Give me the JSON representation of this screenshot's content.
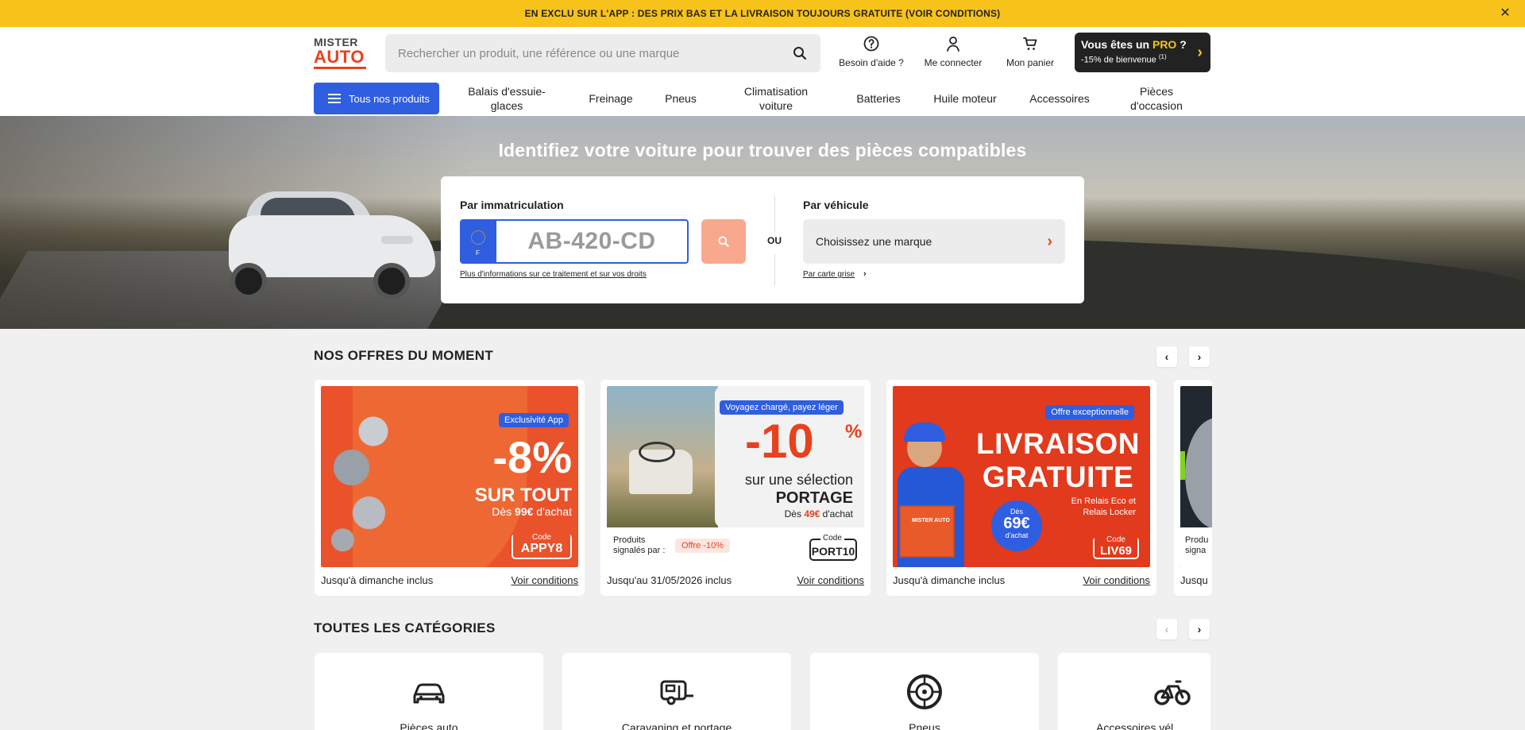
{
  "promo": {
    "text": "EN EXCLU SUR L'APP : DES PRIX BAS ET LA LIVRAISON TOUJOURS GRATUITE (VOIR CONDITIONS)",
    "close_label": "✕"
  },
  "logo": {
    "line1": "MISTER",
    "line2": "AUTO"
  },
  "search": {
    "placeholder": "Rechercher un produit, une référence ou une marque"
  },
  "header_actions": {
    "help": "Besoin d'aide ?",
    "login": "Me connecter",
    "cart": "Mon panier"
  },
  "pro": {
    "prefix": "Vous êtes un ",
    "highlight": "PRO",
    "suffix": " ?",
    "subtitle": "-15% de bienvenue",
    "footnote": "(1)"
  },
  "nav": {
    "all_products": "Tous nos produits",
    "items": [
      "Balais d'essuie-glaces",
      "Freinage",
      "Pneus",
      "Climatisation voiture",
      "Batteries",
      "Huile moteur",
      "Accessoires",
      "Pièces d'occasion"
    ]
  },
  "hero": {
    "title": "Identifiez votre voiture pour trouver des pièces compatibles",
    "plate_label": "Par immatriculation",
    "plate_country": "F",
    "plate_placeholder": "AB-420-CD",
    "or": "OU",
    "privacy_link": "Plus d'informations sur ce traitement et sur vos droits",
    "vehicle_label": "Par véhicule",
    "brand_select": "Choisissez une marque",
    "carte_grise": "Par carte grise"
  },
  "offers": {
    "title": "NOS OFFRES DU MOMENT",
    "cards": [
      {
        "badge": "Exclusivité App",
        "big": "-8%",
        "line": "SUR TOUT",
        "sub_prefix": "Dès ",
        "sub_value": "99€",
        "sub_suffix": " d'achat",
        "code_label": "Code",
        "code": "APPY8",
        "validity": "Jusqu'à dimanche inclus",
        "conditions": "Voir conditions"
      },
      {
        "badge": "Voyagez chargé, payez léger",
        "big": "-10",
        "pct": "%",
        "line": "sur une sélection",
        "line2": "PORTAGE",
        "sub_prefix": "Dès ",
        "sub_value": "49€",
        "sub_suffix": " d'achat",
        "signal": "Produits signalés par :",
        "offer_tag": "Offre -10%",
        "code_label": "Code",
        "code": "PORT10",
        "validity": "Jusqu'au 31/05/2026 inclus",
        "conditions": "Voir conditions"
      },
      {
        "badge": "Offre exceptionnelle",
        "big1": "LIVRAISON",
        "big2": "GRATUITE",
        "circle_1": "Dès",
        "circle_2": "69€",
        "circle_3": "d'achat",
        "small1": "En Relais Eco et",
        "small2": "Relais Locker",
        "box_brand": "MISTER AUTO",
        "code_label": "Code",
        "code": "LIV69",
        "validity": "Jusqu'à dimanche inclus",
        "conditions": "Voir conditions"
      },
      {
        "signal": "Produ signa",
        "validity": "Jusqu"
      }
    ]
  },
  "categories": {
    "title": "TOUTES LES CATÉGORIES",
    "items": [
      {
        "label": "Pièces auto",
        "icon": "car-icon"
      },
      {
        "label": "Caravaning et portage",
        "icon": "caravan-icon"
      },
      {
        "label": "Pneus",
        "icon": "tire-icon"
      },
      {
        "label": "Accessoires vél",
        "icon": "bicycle-icon"
      }
    ]
  },
  "colors": {
    "accent_yellow": "#f7c21a",
    "brand_red": "#e8411e",
    "blue": "#2f5ee0"
  }
}
